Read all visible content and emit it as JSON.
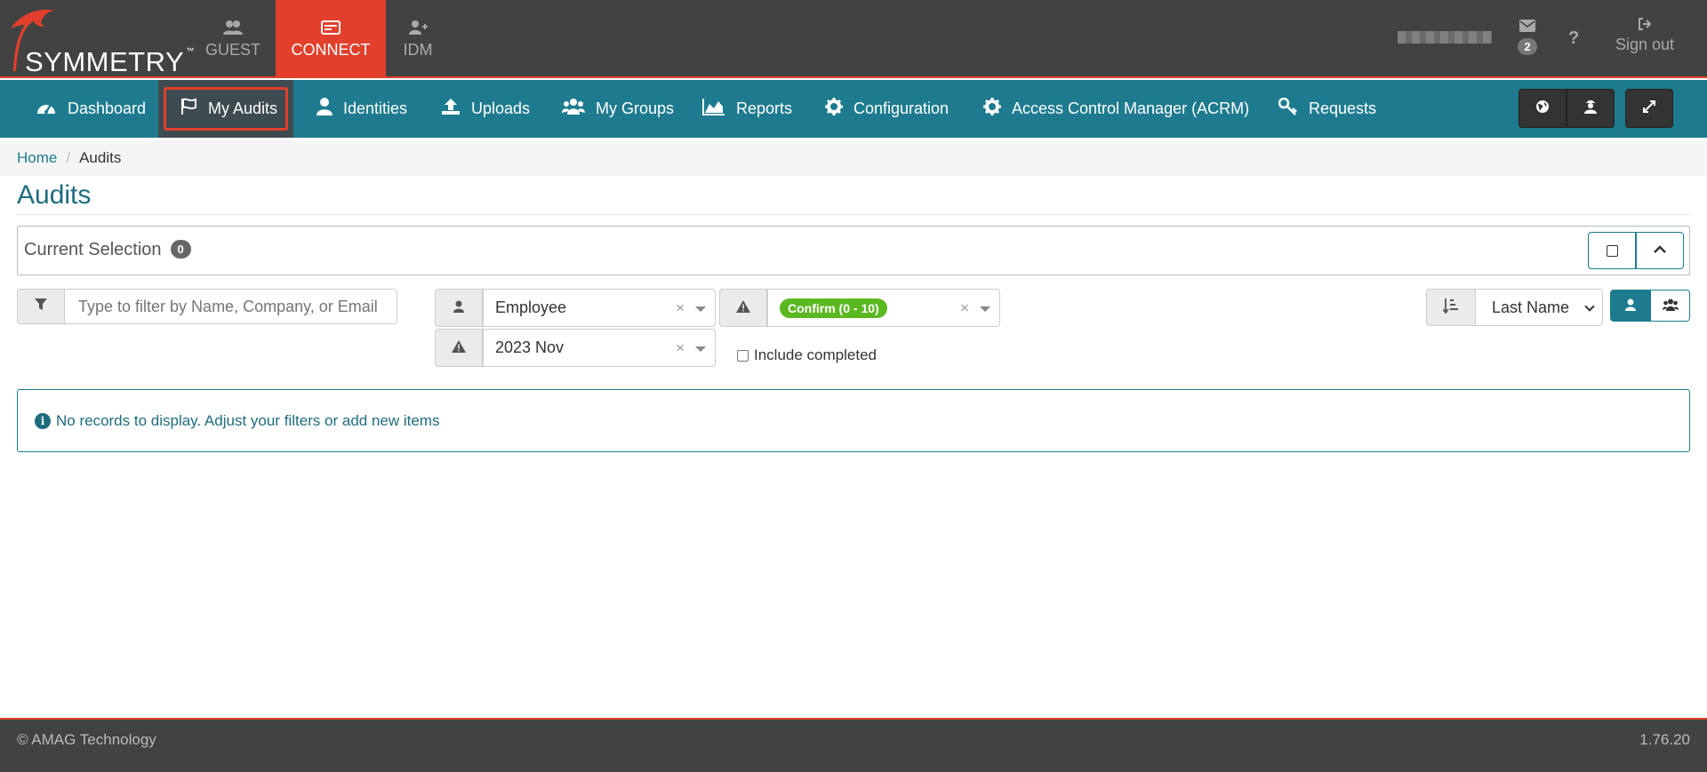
{
  "brand": {
    "logo_text": "SYMMETRY",
    "trademark": "™"
  },
  "app_tabs": [
    {
      "label": "GUEST",
      "icon": "users-plus-icon",
      "active": false
    },
    {
      "label": "CONNECT",
      "icon": "id-card-icon",
      "active": true
    },
    {
      "label": "IDM",
      "icon": "user-plus-icon",
      "active": false
    }
  ],
  "header_right": {
    "messages_count": "2",
    "help_label": "?",
    "signout_label": "Sign out"
  },
  "nav": {
    "items": [
      {
        "label": "Dashboard",
        "icon": "dashboard-icon"
      },
      {
        "label": "My Audits",
        "icon": "flag-icon",
        "active": true
      },
      {
        "label": "Identities",
        "icon": "user-icon"
      },
      {
        "label": "Uploads",
        "icon": "upload-icon"
      },
      {
        "label": "My Groups",
        "icon": "group-icon"
      },
      {
        "label": "Reports",
        "icon": "area-chart-icon"
      },
      {
        "label": "Configuration",
        "icon": "gear-icon"
      },
      {
        "label": "Access Control Manager (ACRM)",
        "icon": "gear-icon"
      },
      {
        "label": "Requests",
        "icon": "key-icon"
      }
    ]
  },
  "breadcrumb": {
    "home": "Home",
    "separator": "/",
    "current": "Audits"
  },
  "page": {
    "title": "Audits"
  },
  "selection": {
    "label": "Current Selection",
    "count": "0"
  },
  "filters": {
    "search_placeholder": "Type to filter by Name, Company, or Email",
    "identity_type": "Employee",
    "status": "Confirm (0 - 10)",
    "period": "2023 Nov",
    "include_completed_label": "Include completed",
    "include_completed_checked": false,
    "sort_by": "Last Name"
  },
  "alert": {
    "message": "No records to display. Adjust your filters or add new items"
  },
  "footer": {
    "copyright": "© AMAG Technology",
    "version": "1.76.20"
  },
  "colors": {
    "accent_red": "#e2402c",
    "nav_teal": "#1e7b8f",
    "header_dark": "#424242",
    "status_green": "#5cb821"
  }
}
